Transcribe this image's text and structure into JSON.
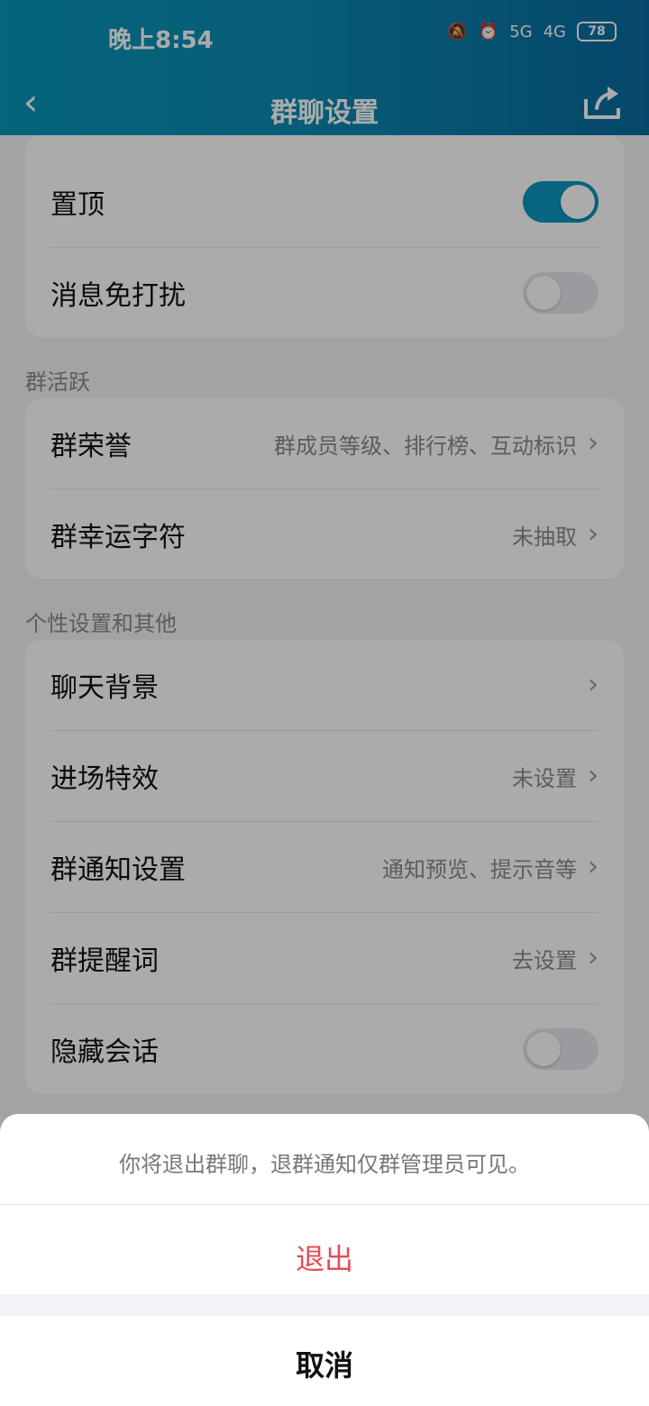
{
  "status_bar": {
    "time": "晚上8:54",
    "network_1": "5G",
    "network_2": "4G",
    "battery": "78"
  },
  "nav": {
    "title": "群聊设置"
  },
  "settings_top": {
    "pin_label": "置顶",
    "pin_on": true,
    "dnd_label": "消息免打扰",
    "dnd_on": false
  },
  "group_activity": {
    "section_title": "群活跃",
    "items": [
      {
        "label": "群荣誉",
        "value": "群成员等级、排行榜、互动标识"
      },
      {
        "label": "群幸运字符",
        "value": "未抽取"
      }
    ]
  },
  "personal": {
    "section_title": "个性设置和其他",
    "items": [
      {
        "label": "聊天背景",
        "value": ""
      },
      {
        "label": "进场特效",
        "value": "未设置"
      },
      {
        "label": "群通知设置",
        "value": "通知预览、提示音等"
      },
      {
        "label": "群提醒词",
        "value": "去设置"
      },
      {
        "label": "隐藏会话",
        "toggle": false
      }
    ]
  },
  "action_sheet": {
    "message": "你将退出群聊，退群通知仅群管理员可见。",
    "exit_label": "退出",
    "cancel_label": "取消"
  },
  "colors": {
    "header_start": "#0a97b7",
    "header_end": "#086b9f",
    "toggle_on": "#0b97c0",
    "danger": "#e54d57"
  }
}
